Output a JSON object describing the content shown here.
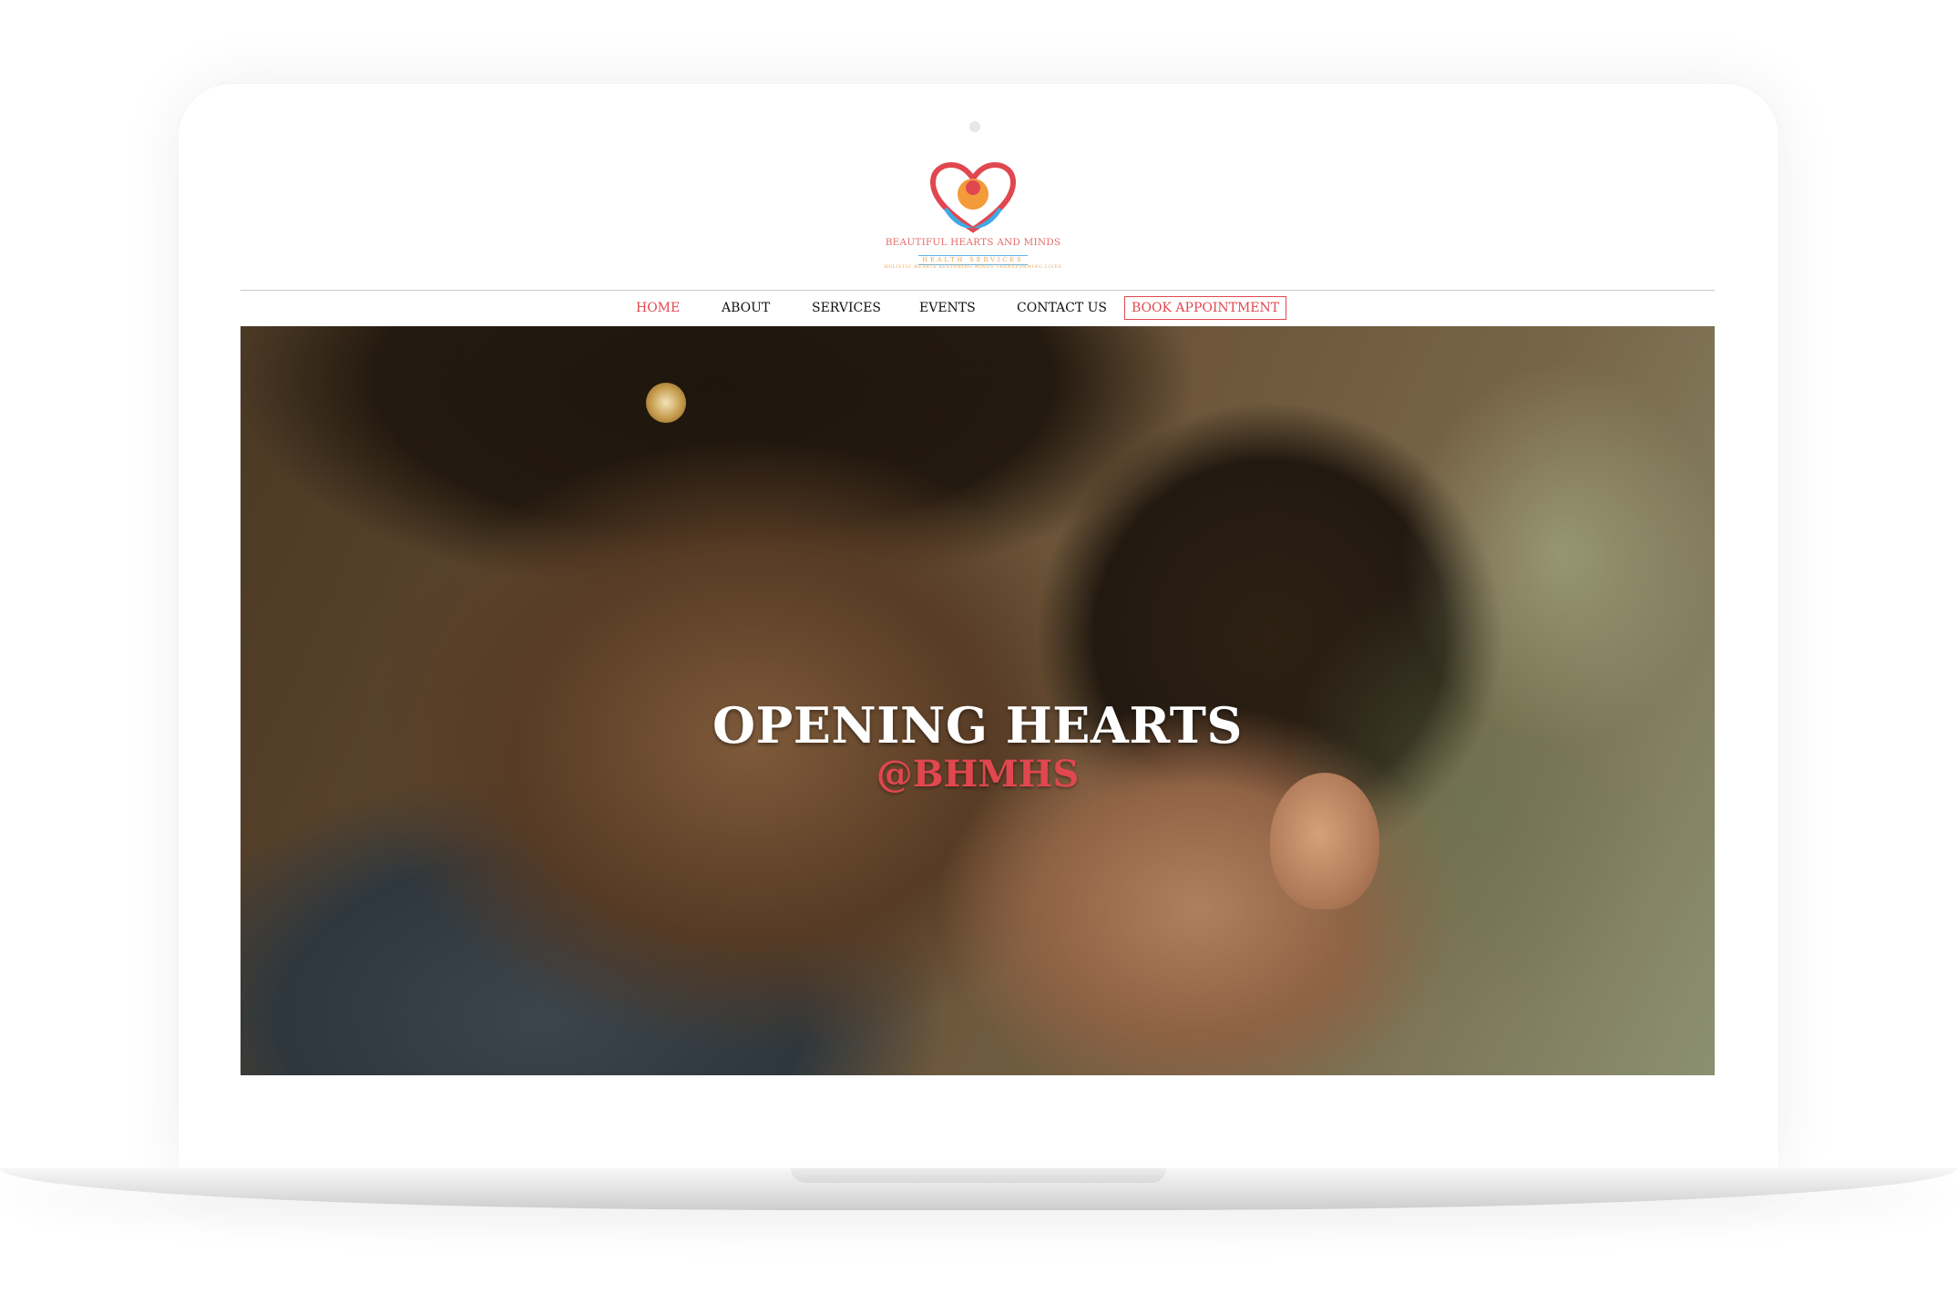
{
  "brand": {
    "name": "BEAUTIFUL HEARTS AND MINDS",
    "subtitle": "HEALTH SERVICES",
    "tagline": "HOLISTIC HEARTS RESTORING MINDS TRANSFORMING LIVES"
  },
  "nav": {
    "items": [
      {
        "label": "HOME",
        "active": true
      },
      {
        "label": "ABOUT"
      },
      {
        "label": "SERVICES"
      },
      {
        "label": "EVENTS"
      },
      {
        "label": "CONTACT US"
      }
    ],
    "cta_label": "BOOK APPOINTMENT"
  },
  "hero": {
    "title": "OPENING HEARTS",
    "subtitle": "@BHMHS"
  },
  "colors": {
    "accent": "#e0474f",
    "logo_blue": "#3fa9e6",
    "logo_orange": "#f0a04b"
  }
}
